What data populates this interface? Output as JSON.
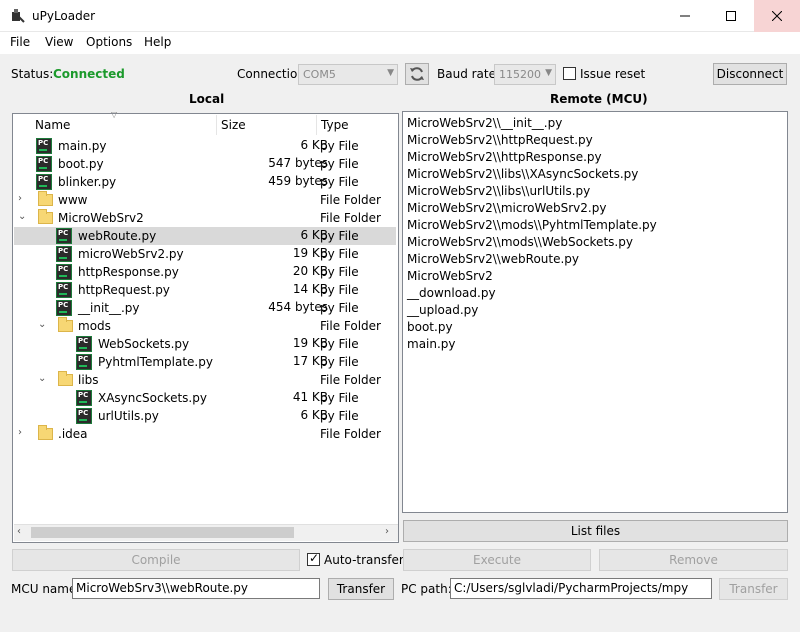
{
  "window": {
    "title": "uPyLoader"
  },
  "menu": [
    "File",
    "View",
    "Options",
    "Help"
  ],
  "status": {
    "label": "Status:",
    "value": "Connected",
    "value_color": "#1c9a2c"
  },
  "connection": {
    "label": "Connection",
    "selected": "COM5"
  },
  "baud": {
    "label": "Baud rate:",
    "selected": "115200"
  },
  "issue_reset": {
    "label": "Issue reset",
    "checked": false
  },
  "disconnect_label": "Disconnect",
  "local": {
    "title": "Local",
    "columns": [
      "Name",
      "Size",
      "Type"
    ],
    "rows": [
      {
        "name": "main.py",
        "size": "6 KB",
        "type": "py File",
        "icon": "python-file-icon"
      },
      {
        "name": "boot.py",
        "size": "547 bytes",
        "type": "py File",
        "icon": "python-file-icon"
      },
      {
        "name": "blinker.py",
        "size": "459 bytes",
        "type": "py File",
        "icon": "python-file-icon"
      },
      {
        "name": "www",
        "size": "",
        "type": "File Folder",
        "icon": "folder-icon"
      },
      {
        "name": "MicroWebSrv2",
        "size": "",
        "type": "File Folder",
        "icon": "folder-icon"
      },
      {
        "name": "webRoute.py",
        "size": "6 KB",
        "type": "py File",
        "icon": "python-file-icon"
      },
      {
        "name": "microWebSrv2.py",
        "size": "19 KB",
        "type": "py File",
        "icon": "python-file-icon"
      },
      {
        "name": "httpResponse.py",
        "size": "20 KB",
        "type": "py File",
        "icon": "python-file-icon"
      },
      {
        "name": "httpRequest.py",
        "size": "14 KB",
        "type": "py File",
        "icon": "python-file-icon"
      },
      {
        "name": "__init__.py",
        "size": "454 bytes",
        "type": "py File",
        "icon": "python-file-icon"
      },
      {
        "name": "mods",
        "size": "",
        "type": "File Folder",
        "icon": "folder-icon"
      },
      {
        "name": "WebSockets.py",
        "size": "19 KB",
        "type": "py File",
        "icon": "python-file-icon"
      },
      {
        "name": "PyhtmlTemplate.py",
        "size": "17 KB",
        "type": "py File",
        "icon": "python-file-icon"
      },
      {
        "name": "libs",
        "size": "",
        "type": "File Folder",
        "icon": "folder-icon"
      },
      {
        "name": "XAsyncSockets.py",
        "size": "41 KB",
        "type": "py File",
        "icon": "python-file-icon"
      },
      {
        "name": "urlUtils.py",
        "size": "6 KB",
        "type": "py File",
        "icon": "python-file-icon"
      },
      {
        "name": ".idea",
        "size": "",
        "type": "File Folder",
        "icon": "folder-icon"
      }
    ]
  },
  "remote": {
    "title": "Remote (MCU)",
    "items": [
      "MicroWebSrv2\\\\__init__.py",
      "MicroWebSrv2\\\\httpRequest.py",
      "MicroWebSrv2\\\\httpResponse.py",
      "MicroWebSrv2\\\\libs\\\\XAsyncSockets.py",
      "MicroWebSrv2\\\\libs\\\\urlUtils.py",
      "MicroWebSrv2\\\\microWebSrv2.py",
      "MicroWebSrv2\\\\mods\\\\PyhtmlTemplate.py",
      "MicroWebSrv2\\\\mods\\\\WebSockets.py",
      "MicroWebSrv2\\\\webRoute.py",
      "MicroWebSrv2",
      "__download.py",
      "__upload.py",
      "boot.py",
      "main.py"
    ]
  },
  "buttons": {
    "list_files": "List files",
    "compile": "Compile",
    "execute": "Execute",
    "remove": "Remove",
    "transfer": "Transfer",
    "transfer_disabled": "Transfer"
  },
  "auto_transfer": {
    "label": "Auto-transfer",
    "checked": true
  },
  "mcu_name": {
    "label": "MCU name:",
    "value": "MicroWebSrv3\\\\webRoute.py"
  },
  "pc_path": {
    "label": "PC path:",
    "value": "C:/Users/sglvladi/PycharmProjects/mpy"
  }
}
